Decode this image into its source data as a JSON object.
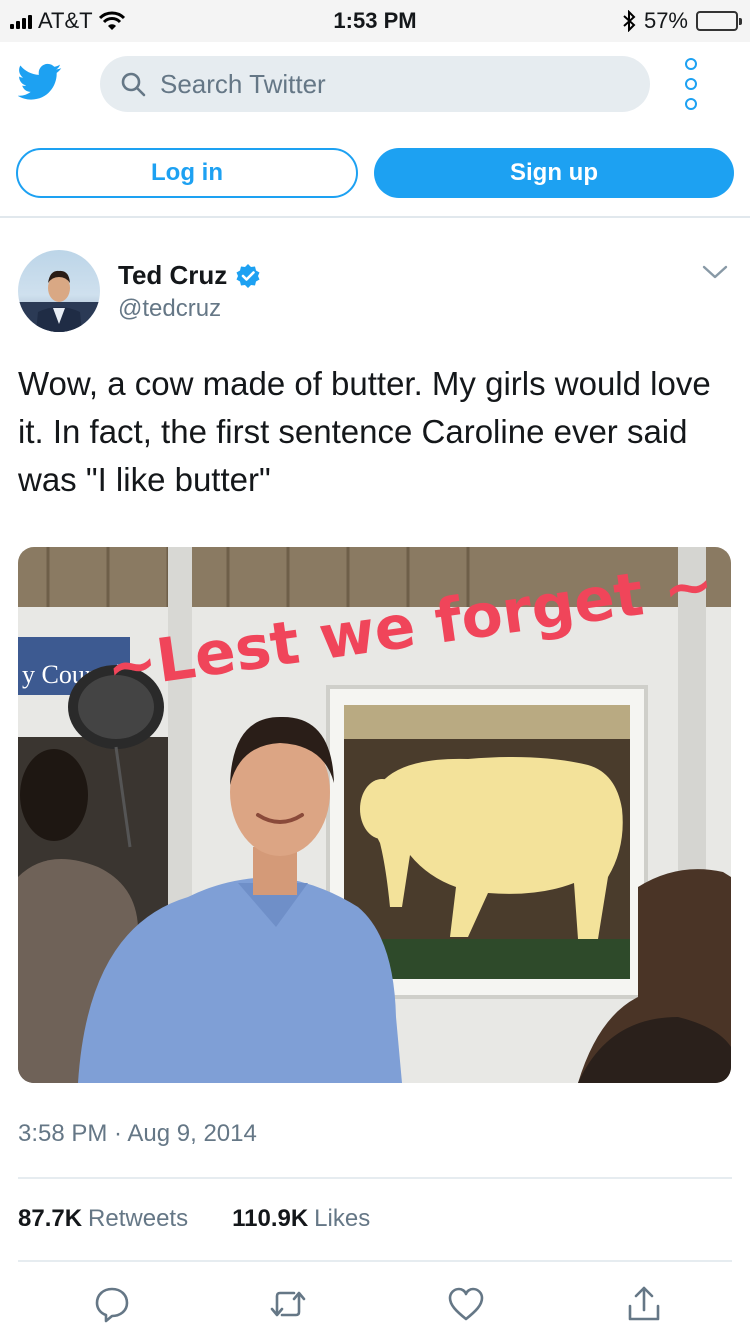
{
  "status_bar": {
    "carrier": "AT&T",
    "time": "1:53 PM",
    "battery": "57%",
    "battery_level": 0.57
  },
  "search": {
    "placeholder": "Search Twitter"
  },
  "auth": {
    "login_label": "Log in",
    "signup_label": "Sign up"
  },
  "tweet": {
    "author_name": "Ted Cruz",
    "author_handle": "@tedcruz",
    "verified": true,
    "text": "Wow, a cow made of butter. My girls would love it. In fact, the first sentence Caroline ever said was \"I like butter\"",
    "image_overlay_text": "~Lest we forget ~",
    "image_sign_text": "y Council",
    "timestamp": "3:58 PM · Aug 9, 2014",
    "retweets_count": "87.7K",
    "retweets_label": "Retweets",
    "likes_count": "110.9K",
    "likes_label": "Likes"
  },
  "icons": {
    "brand": "twitter-bird-icon",
    "accent_color": "#1da1f2",
    "overlay_color": "#f0455a"
  }
}
